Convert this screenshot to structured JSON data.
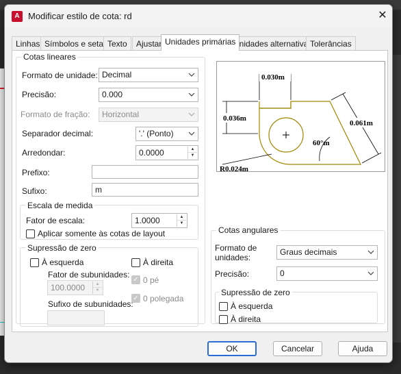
{
  "window": {
    "title": "Modificar estilo de cota: rd",
    "app_icon": "A"
  },
  "tabs": [
    {
      "label": "Linhas",
      "active": false
    },
    {
      "label": "Símbolos e setas",
      "active": false
    },
    {
      "label": "Texto",
      "active": false
    },
    {
      "label": "Ajustar",
      "active": false
    },
    {
      "label": "Unidades primárias",
      "active": true
    },
    {
      "label": "Unidades alternativas",
      "active": false
    },
    {
      "label": "Tolerâncias",
      "active": false
    }
  ],
  "linear": {
    "legend": "Cotas lineares",
    "unit_format": {
      "label": "Formato de unidade:",
      "value": "Decimal"
    },
    "precision": {
      "label": "Precisão:",
      "value": "0.000"
    },
    "fraction_format": {
      "label": "Formato de fração:",
      "value": "Horizontal"
    },
    "decimal_separator": {
      "label": "Separador decimal:",
      "value": "'.' (Ponto)"
    },
    "round_off": {
      "label": "Arredondar:",
      "value": "0.0000"
    },
    "prefix": {
      "label": "Prefixo:",
      "value": ""
    },
    "suffix": {
      "label": "Sufixo:",
      "value": "m"
    },
    "scale": {
      "legend": "Escala de medida",
      "factor_label": "Fator de escala:",
      "factor_value": "1.0000",
      "layout_only_label": "Aplicar somente às cotas de layout"
    },
    "zero_suppression": {
      "legend": "Supressão de zero",
      "leading": "À esquerda",
      "trailing": "À direita",
      "subunit_factor_label": "Fator de subunidades:",
      "subunit_factor_value": "100.0000",
      "subunit_suffix_label": "Sufixo de subunidades:",
      "feet": "0 pé",
      "inches": "0 polegada"
    }
  },
  "angular": {
    "legend": "Cotas angulares",
    "units_format": {
      "label": "Formato de unidades:",
      "value": "Graus decimais"
    },
    "precision": {
      "label": "Precisão:",
      "value": "0"
    },
    "zero_suppression": {
      "legend": "Supressão de zero",
      "leading": "À esquerda",
      "trailing": "À direita"
    }
  },
  "preview": {
    "dim_top": "0.030m",
    "dim_left": "0.036m",
    "dim_right": "0.061m",
    "dim_angle": "60°m",
    "dim_radius": "R0.024m"
  },
  "buttons": {
    "ok": "OK",
    "cancel": "Cancelar",
    "help": "Ajuda"
  },
  "colors": {
    "accent": "#2a6cd4",
    "app_icon": "#c8102e",
    "preview_outline": "#a08600"
  }
}
